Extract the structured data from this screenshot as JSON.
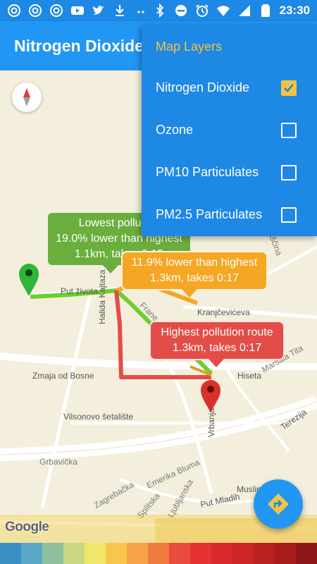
{
  "status_bar": {
    "time": "23:30",
    "left_icons": [
      "at-sign-icon",
      "at-sign-icon",
      "at-sign-icon",
      "youtube-icon",
      "twitter-icon",
      "download-icon",
      "more-dots-icon"
    ],
    "right_icons": [
      "bluetooth-icon",
      "do-not-disturb-icon",
      "alarm-icon",
      "wifi-icon",
      "signal-icon",
      "battery-icon"
    ]
  },
  "app_bar": {
    "title": "Nitrogen Dioxide"
  },
  "menu": {
    "title": "Map Layers",
    "items": [
      {
        "label": "Nitrogen Dioxide",
        "checked": true
      },
      {
        "label": "Ozone",
        "checked": false
      },
      {
        "label": "PM10 Particulates",
        "checked": false
      },
      {
        "label": "PM2.5 Particulates",
        "checked": false
      }
    ]
  },
  "map": {
    "streets": {
      "putzivota": "Put života",
      "kranjceviceva": "Kranjčevićeva",
      "hisetа": "Hiseta",
      "zmaja": "Zmaja od Bosne",
      "vilsonovo": "Vilsonovo šetalište",
      "halida": "Halida Kajtaza",
      "vrbanja": "Vrbanja",
      "terezija": "Terezija",
      "grbavicka": "Grbavička",
      "zagrebacka": "Zagrebačka",
      "splitska": "Splitska",
      "ljubljanska": "Ljubljanska",
      "emerika": "Emerika Bluma",
      "putmladih": "Put Mladih",
      "muslima": "Muslima",
      "marsala": "Maršala Tita",
      "bastina": "Baščina",
      "frane": "Frane"
    },
    "callouts": {
      "lowest_line1": "Lowest pollution",
      "lowest_line2": "19.0% lower than highest",
      "lowest_line3": "1.1km, takes 0:15",
      "mid_line1": "11.9% lower than highest",
      "mid_line2": "1.3km, takes 0:17",
      "highest_line1": "Highest pollution route",
      "highest_line2": "1.3km, takes 0:17"
    },
    "attribution": "Google"
  },
  "colors": {
    "primary": "#2196f3",
    "primary_dark": "#1e88e5",
    "accent": "#f5c242",
    "low_route": "#6ccf2e",
    "mid_route": "#f5a623",
    "high_route": "#e34d47"
  },
  "scale_colors": [
    "#3a8fc4",
    "#5aa8c8",
    "#8dbf9c",
    "#c8d883",
    "#f0e66a",
    "#f9c64d",
    "#f7a34a",
    "#f07a3b",
    "#e74c3c",
    "#e53232",
    "#d92b2b",
    "#cc2626",
    "#bb2020",
    "#a61b1b",
    "#8f1717"
  ]
}
